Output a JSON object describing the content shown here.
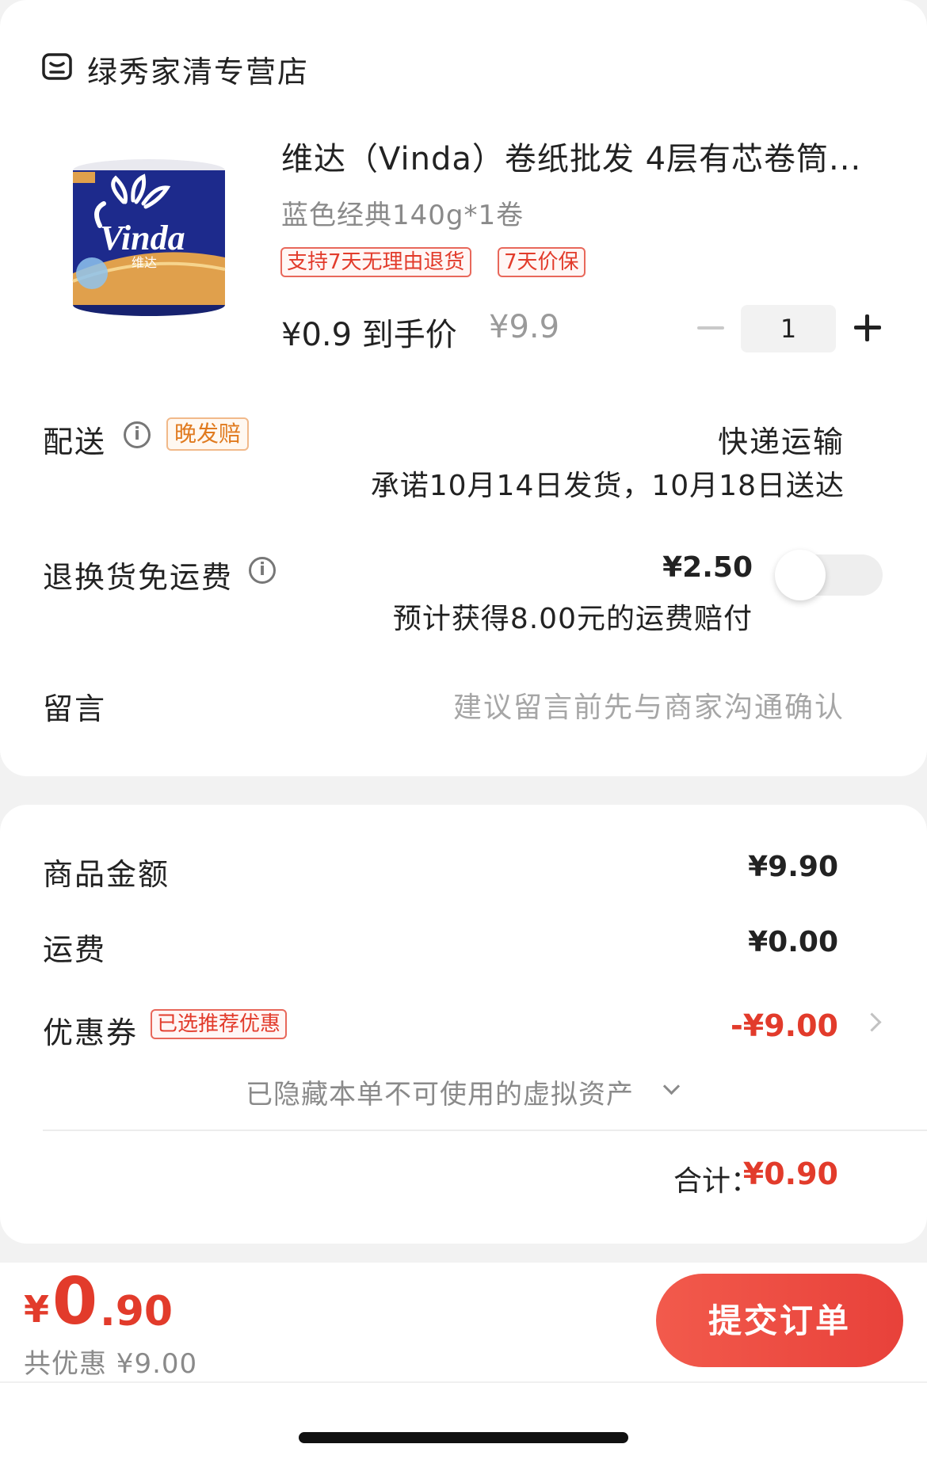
{
  "store": {
    "name": "绿秀家清专营店"
  },
  "product": {
    "brand_logo_text": "Vinda",
    "brand_logo_sub": "维达",
    "title": "维达（Vinda）卷纸批发 4层有芯卷筒...",
    "spec": "蓝色经典140g*1卷",
    "tags": [
      "支持7天无理由退货",
      "7天价保"
    ],
    "price_text": "¥0.9 到手价",
    "original_price": "¥9.9",
    "quantity": "1"
  },
  "delivery": {
    "label": "配送",
    "late_tag": "晚发赔",
    "method": "快递运输",
    "promise": "承诺10月14日发货，10月18日送达"
  },
  "return_shipping": {
    "label": "退换货免运费",
    "price": "¥2.50",
    "note": "预计获得8.00元的运费赔付",
    "enabled": false
  },
  "message": {
    "label": "留言",
    "placeholder": "建议留言前先与商家沟通确认"
  },
  "summary": {
    "goods_label": "商品金额",
    "goods_value": "¥9.90",
    "shipping_label": "运费",
    "shipping_value": "¥0.00",
    "coupon_label": "优惠券",
    "coupon_tag": "已选推荐优惠",
    "coupon_value": "-¥9.00",
    "hidden_assets": "已隐藏本单不可使用的虚拟资产",
    "total_label": "合计：",
    "total_value": "¥0.90"
  },
  "bottom": {
    "currency": "¥",
    "price_int": "0",
    "price_dec": ".90",
    "saved": "共优惠 ¥9.00",
    "submit": "提交订单"
  },
  "colors": {
    "accent": "#e23b2b",
    "button": "#ef4c42",
    "warning": "#e07a1f"
  }
}
